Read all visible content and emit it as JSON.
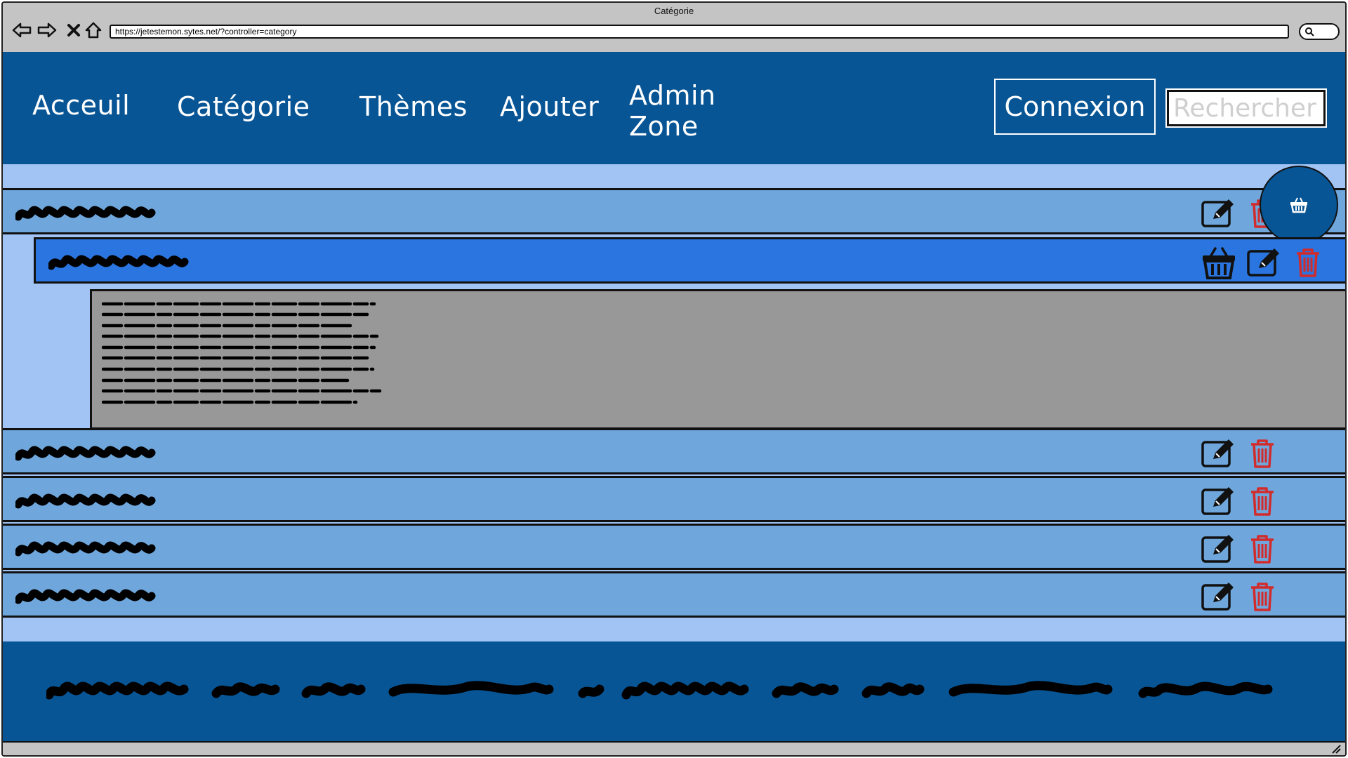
{
  "window": {
    "title": "Catégorie"
  },
  "browser": {
    "url": "https://jetestemon.sytes.net/?controller=category"
  },
  "nav": {
    "items": [
      {
        "label": "Acceuil"
      },
      {
        "label": "Catégorie"
      },
      {
        "label": "Thèmes"
      },
      {
        "label": "Ajouter"
      },
      {
        "label": "Admin",
        "label2": "Zone"
      }
    ],
    "login_label": "Connexion",
    "search_placeholder": "Rechercher"
  },
  "icons": {
    "edit": "pencil-square-icon",
    "delete": "trash-icon",
    "basket": "basket-icon"
  },
  "colors": {
    "header": "#085595",
    "page_bg": "#a1c4f5",
    "row": "#6fa7dd",
    "row_selected": "#2a75df",
    "description": "#989898",
    "delete_icon": "#d22b2b"
  }
}
